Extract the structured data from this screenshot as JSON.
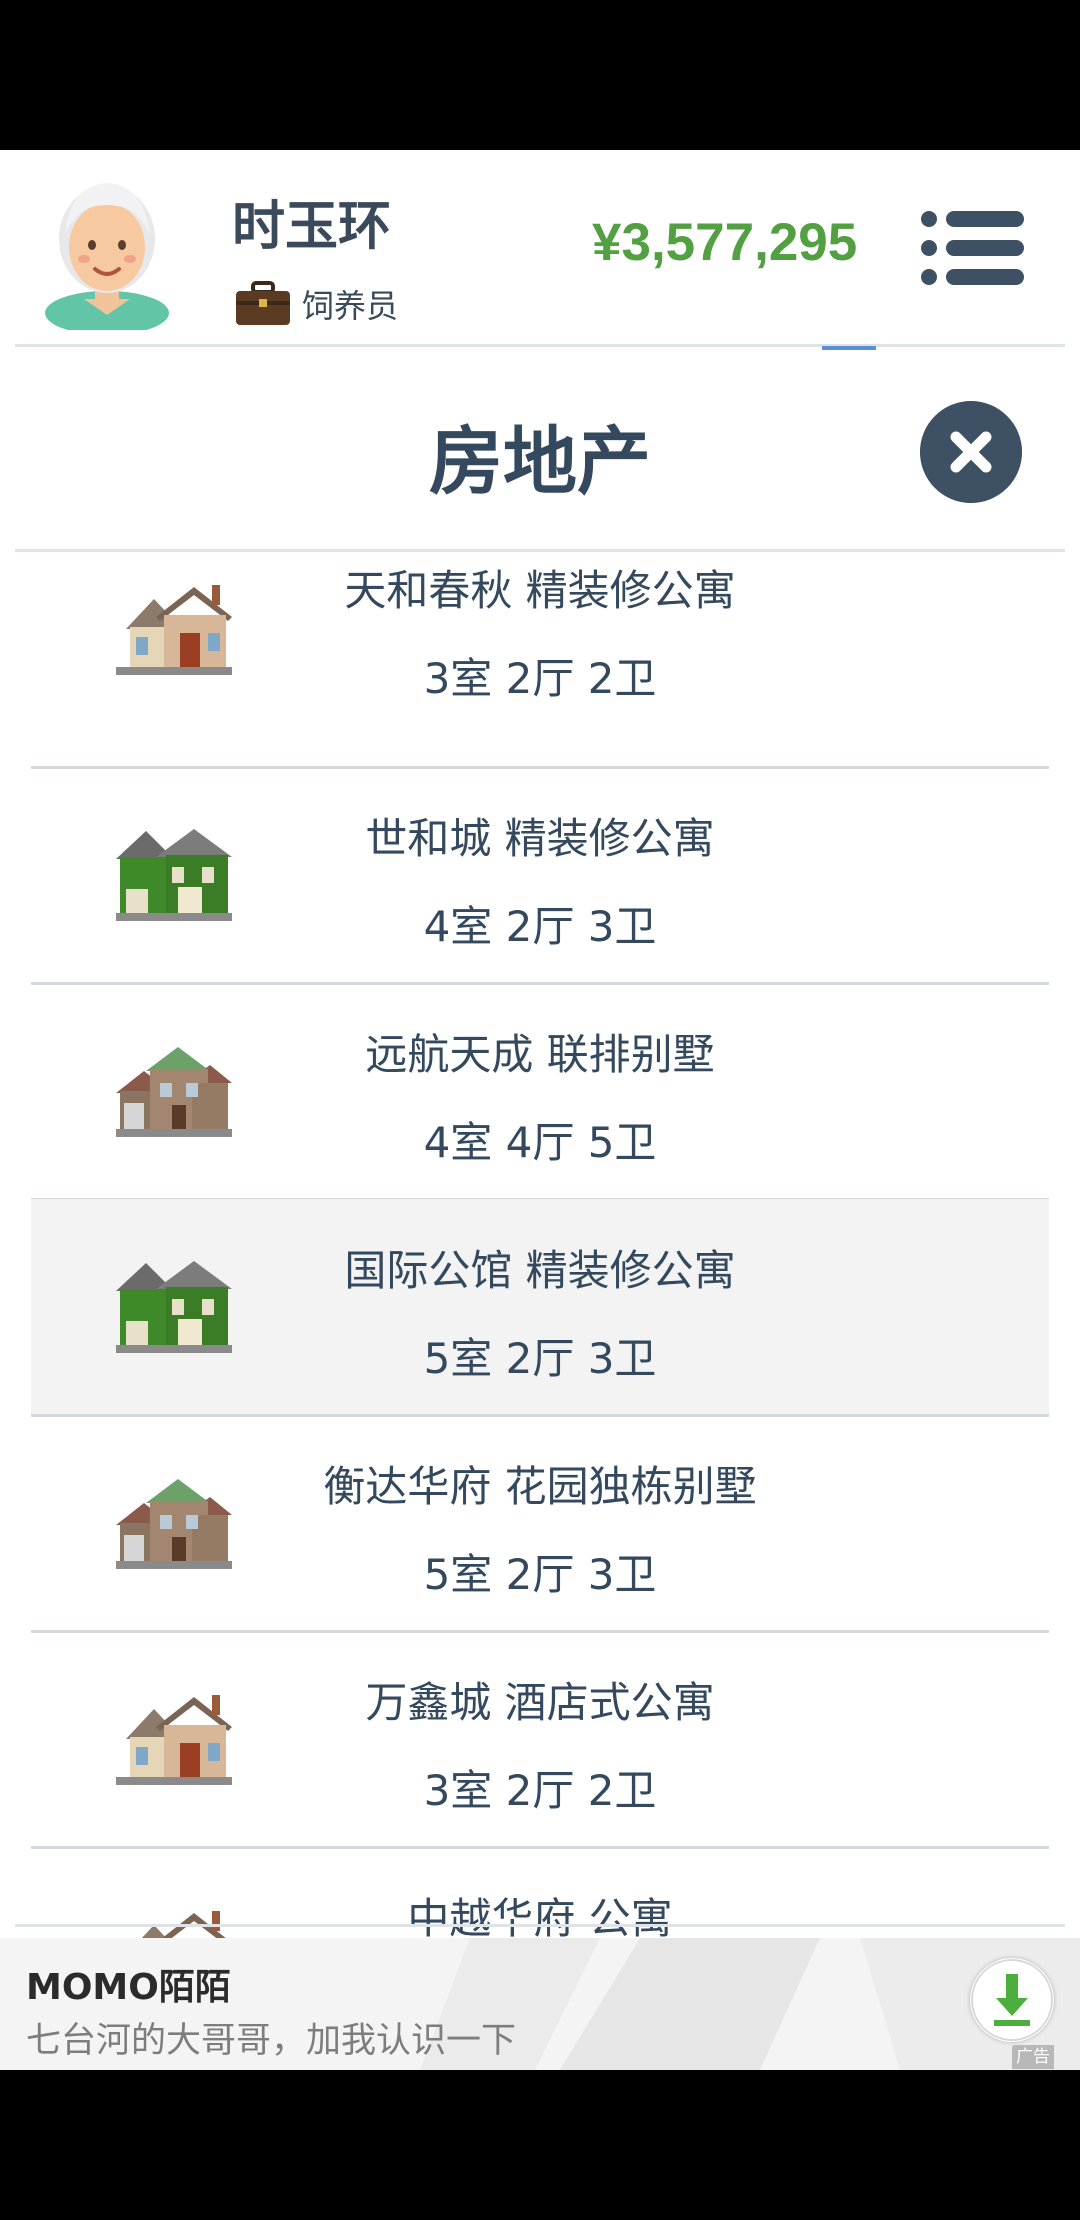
{
  "header": {
    "player_name": "时玉环",
    "job": "饲养员",
    "money": "¥3,577,295"
  },
  "section": {
    "title": "房地产"
  },
  "properties": [
    {
      "name": "天和春秋 精装修公寓",
      "rooms": "3室 2厅 2卫",
      "icon": "house-brown-icon",
      "selected": false
    },
    {
      "name": "世和城 精装修公寓",
      "rooms": "4室 2厅 3卫",
      "icon": "house-green-icon",
      "selected": false
    },
    {
      "name": "远航天成 联排别墅",
      "rooms": "4室 4厅 5卫",
      "icon": "townhouse-icon",
      "selected": false
    },
    {
      "name": "国际公馆 精装修公寓",
      "rooms": "5室 2厅 3卫",
      "icon": "house-green-icon",
      "selected": true
    },
    {
      "name": "衡达华府 花园独栋别墅",
      "rooms": "5室 2厅 3卫",
      "icon": "townhouse-icon",
      "selected": false
    },
    {
      "name": "万鑫城 酒店式公寓",
      "rooms": "3室 2厅 2卫",
      "icon": "house-brown-icon",
      "selected": false
    },
    {
      "name": "中越华府 公寓",
      "rooms": "",
      "icon": "house-brown-icon",
      "selected": false
    }
  ],
  "ad": {
    "title": "MOMO陌陌",
    "text": "七台河的大哥哥，加我认识一下",
    "badge": "广告"
  },
  "colors": {
    "money": "#52a041",
    "title": "#34495e",
    "close_button": "#3e5164",
    "selected_row": "#f3f3f3"
  }
}
